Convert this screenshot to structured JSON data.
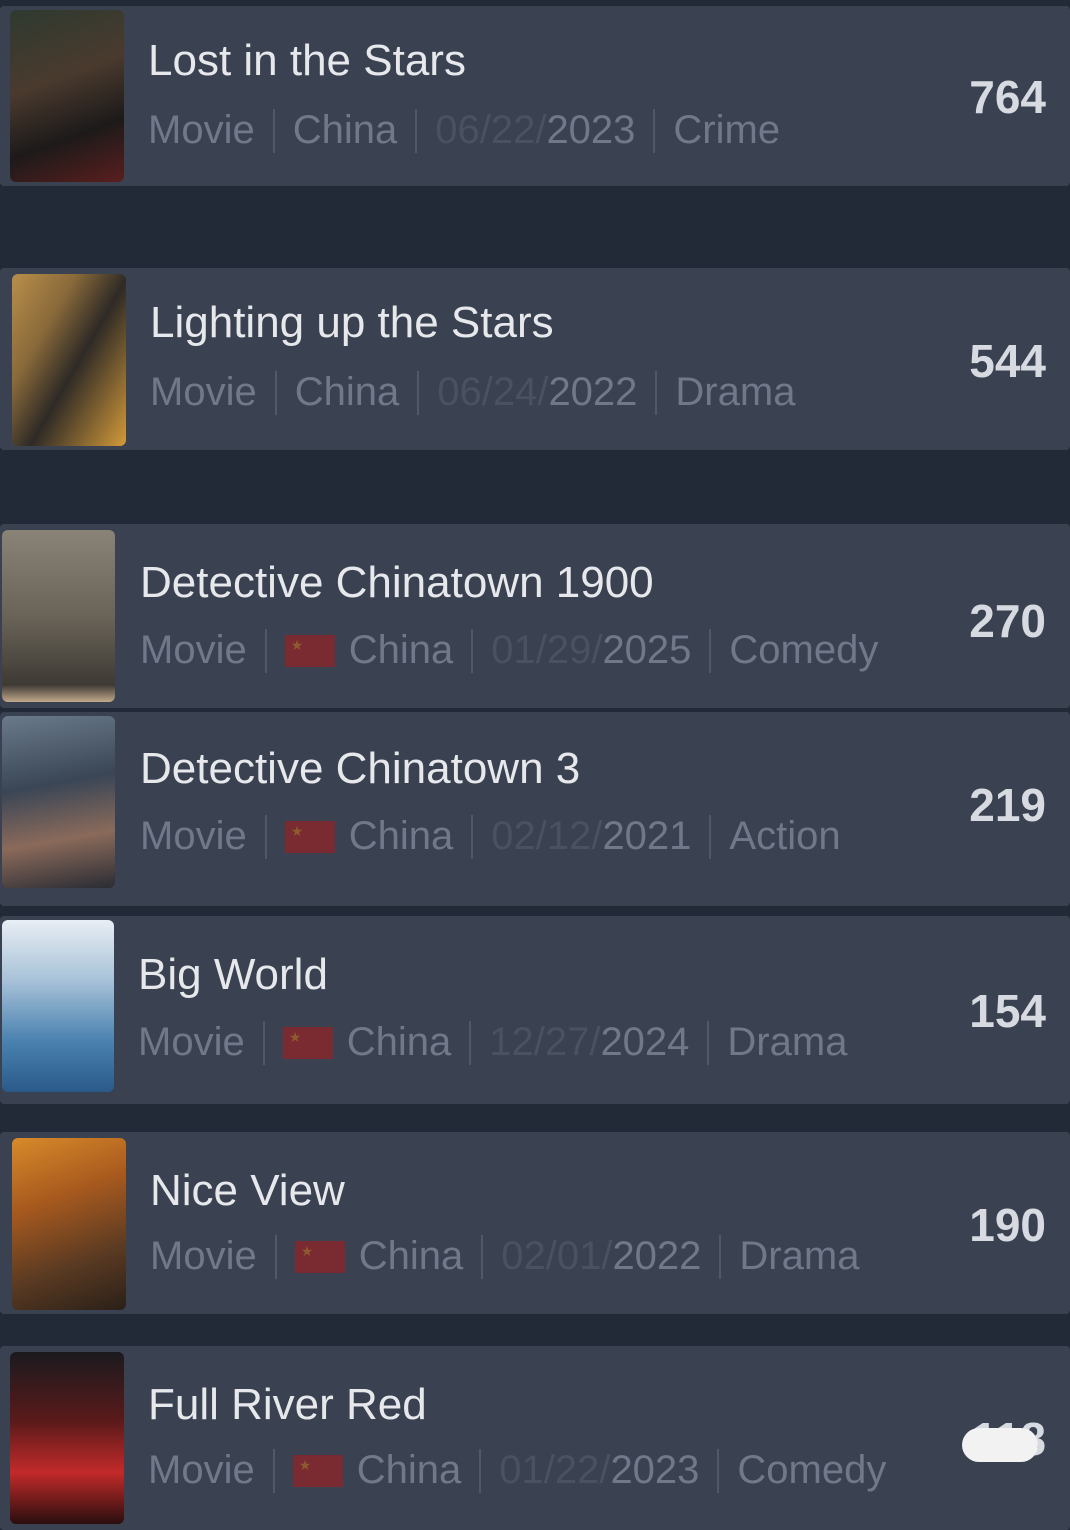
{
  "items": [
    {
      "title": "Lost in the Stars",
      "type": "Movie",
      "country": "China",
      "date_md": "06/22/",
      "date_year": "2023",
      "genre": "Crime",
      "score": "764",
      "has_flag": false
    },
    {
      "title": "Lighting up the Stars",
      "type": "Movie",
      "country": "China",
      "date_md": "06/24/",
      "date_year": "2022",
      "genre": "Drama",
      "score": "544",
      "has_flag": false
    },
    {
      "title": "Detective Chinatown 1900",
      "type": "Movie",
      "country": "China",
      "date_md": "01/29/",
      "date_year": "2025",
      "genre": "Comedy",
      "score": "270",
      "has_flag": true
    },
    {
      "title": "Detective Chinatown 3",
      "type": "Movie",
      "country": "China",
      "date_md": "02/12/",
      "date_year": "2021",
      "genre": "Action",
      "score": "219",
      "has_flag": true
    },
    {
      "title": "Big World",
      "type": "Movie",
      "country": "China",
      "date_md": "12/27/",
      "date_year": "2024",
      "genre": "Drama",
      "score": "154",
      "has_flag": true
    },
    {
      "title": "Nice View",
      "type": "Movie",
      "country": "China",
      "date_md": "02/01/",
      "date_year": "2022",
      "genre": "Drama",
      "score": "190",
      "has_flag": true
    },
    {
      "title": "Full River Red",
      "type": "Movie",
      "country": "China",
      "date_md": "01/22/",
      "date_year": "2023",
      "genre": "Comedy",
      "score": "118",
      "has_flag": true
    }
  ],
  "colors": {
    "background": "#232a37",
    "card": "#3a4150",
    "title": "#e6e8ec",
    "meta": "#70788a",
    "flag": "#7a2a31"
  }
}
